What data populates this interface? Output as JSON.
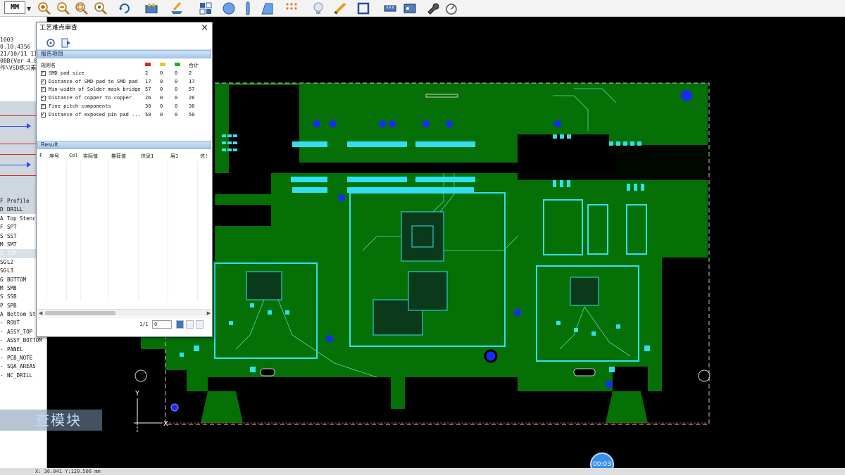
{
  "toolbar": {
    "unit": "MM",
    "icons": [
      "zoom-in-icon",
      "zoom-out-icon",
      "zoom-window-icon",
      "zoom-fit-icon",
      "rotate-icon",
      "layer-icon",
      "move-icon",
      "select-icon",
      "circle-icon",
      "line-icon",
      "shape-icon",
      "grid-icon",
      "bulb-icon",
      "pencil-icon",
      "square-icon",
      "measure-icon",
      "tool-icon",
      "compass-icon"
    ]
  },
  "left_panel": {
    "info_lines": [
      "1003",
      "0.10.4356",
      "21/10/11 11.1",
      "0BB(Ver 4.0.",
      "作\\VSD练习素"
    ],
    "layers": [
      {
        "type": "F",
        "name": "Profile"
      },
      {
        "type": "D",
        "name": "DRILL"
      },
      {
        "type": "A",
        "name": "Top Stenc"
      },
      {
        "type": "F",
        "name": "SPT"
      },
      {
        "type": "S",
        "name": "SST"
      },
      {
        "type": "M",
        "name": "SMT"
      },
      {
        "type": "S",
        "name": "TOP"
      },
      {
        "type": "SG",
        "name": "L2"
      },
      {
        "type": "SG",
        "name": "L3"
      },
      {
        "type": "G",
        "name": "BOTTOM"
      },
      {
        "type": "M",
        "name": "SMB"
      },
      {
        "type": "S",
        "name": "SSB"
      },
      {
        "type": "P",
        "name": "SPB"
      },
      {
        "type": "A",
        "name": "Bottom St"
      },
      {
        "type": "-",
        "name": "ROUT"
      },
      {
        "type": "-",
        "name": "ASSY_TOP"
      },
      {
        "type": "-",
        "name": "ASSY_BOTTOM"
      },
      {
        "type": "-",
        "name": "PANEL"
      },
      {
        "type": "-",
        "name": "PCB_NOTE"
      },
      {
        "type": "-",
        "name": "SQA_AREAS"
      },
      {
        "type": "-",
        "name": "NC_DRILL"
      }
    ]
  },
  "dialog": {
    "title": "工艺难点审查",
    "close": "×",
    "report_section": "报告项目",
    "rules_header": {
      "name": "规则名",
      "total": "合计"
    },
    "status_colors": {
      "red": "#e02020",
      "yellow": "#e8c820",
      "green": "#20b030"
    },
    "rules": [
      {
        "name": "SMD pad size",
        "red": "2",
        "yellow": "0",
        "green": "0",
        "total": "2"
      },
      {
        "name": "Distance of SMD pad to SMD pad",
        "red": "17",
        "yellow": "0",
        "green": "0",
        "total": "17"
      },
      {
        "name": "Min-width of Solder mask bridge",
        "red": "57",
        "yellow": "0",
        "green": "0",
        "total": "57"
      },
      {
        "name": "Distance of copper to copper",
        "red": "26",
        "yellow": "0",
        "green": "0",
        "total": "26"
      },
      {
        "name": "Fine pitch components",
        "red": "30",
        "yellow": "0",
        "green": "0",
        "total": "30"
      },
      {
        "name": "Distance of exposed pin pad ...",
        "red": "50",
        "yellow": "0",
        "green": "0",
        "total": "50"
      }
    ],
    "result_section": "Result",
    "result_columns": [
      "F",
      "序号",
      "Col",
      "实际值",
      "推荐值",
      "信息1",
      "层1",
      "信!"
    ],
    "page_text": "1/1",
    "page_input": "0"
  },
  "board": {
    "axis_x": "X",
    "axis_y": "Y"
  },
  "status": {
    "coords": "X: 36.041  Y:120.506 mm"
  },
  "overlay": {
    "watermark": "查模块",
    "timer": "00:03"
  }
}
